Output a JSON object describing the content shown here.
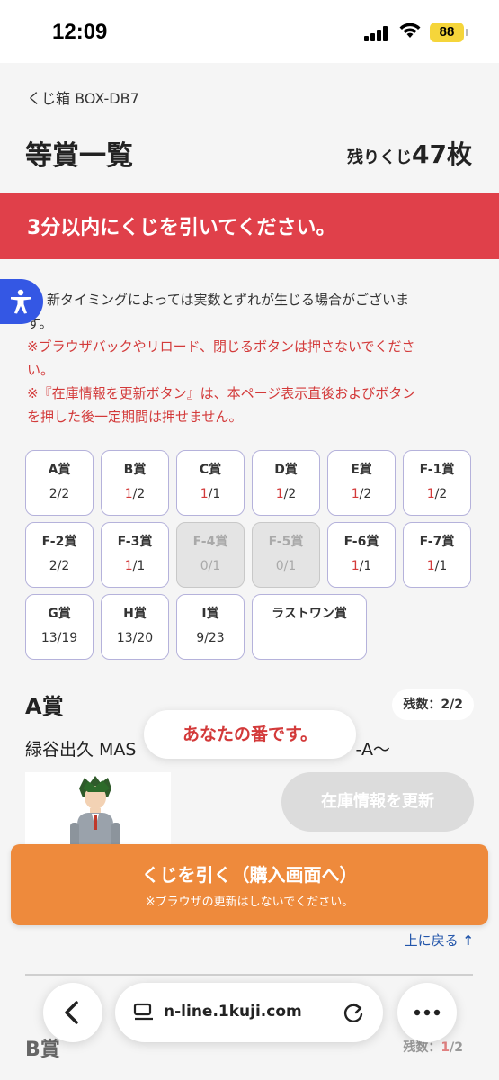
{
  "status": {
    "time": "12:09",
    "battery": "88"
  },
  "header": {
    "breadcrumb": "くじ箱 BOX-DB7",
    "title": "等賞一覧",
    "remaining_prefix": "残りくじ",
    "remaining_count": "47枚"
  },
  "alert": {
    "text": "3分以内にくじを引いてください。"
  },
  "notes": {
    "line1": "新タイミングによっては実数とずれが生じる場合がございま",
    "line2": "す。",
    "warn1": "※ブラウザバックやリロード、閉じるボタンは押さないでくださ",
    "warn2": "い。",
    "warn3": "※『在庫情報を更新ボタン』は、本ページ表示直後およびボタン",
    "warn4": "を押した後一定期間は押せません。"
  },
  "prizes": [
    {
      "name": "A賞",
      "left": "2",
      "total": "/2",
      "highlight": false,
      "disabled": false
    },
    {
      "name": "B賞",
      "left": "1",
      "total": "/2",
      "highlight": true,
      "disabled": false
    },
    {
      "name": "C賞",
      "left": "1",
      "total": "/1",
      "highlight": true,
      "disabled": false
    },
    {
      "name": "D賞",
      "left": "1",
      "total": "/2",
      "highlight": true,
      "disabled": false
    },
    {
      "name": "E賞",
      "left": "1",
      "total": "/2",
      "highlight": true,
      "disabled": false
    },
    {
      "name": "F-1賞",
      "left": "1",
      "total": "/2",
      "highlight": true,
      "disabled": false
    },
    {
      "name": "F-2賞",
      "left": "2",
      "total": "/2",
      "highlight": false,
      "disabled": false
    },
    {
      "name": "F-3賞",
      "left": "1",
      "total": "/1",
      "highlight": true,
      "disabled": false
    },
    {
      "name": "F-4賞",
      "left": "0",
      "total": "/1",
      "highlight": false,
      "disabled": true
    },
    {
      "name": "F-5賞",
      "left": "0",
      "total": "/1",
      "highlight": false,
      "disabled": true
    },
    {
      "name": "F-6賞",
      "left": "1",
      "total": "/1",
      "highlight": true,
      "disabled": false
    },
    {
      "name": "F-7賞",
      "left": "1",
      "total": "/1",
      "highlight": true,
      "disabled": false
    },
    {
      "name": "G賞",
      "left": "13",
      "total": "/19",
      "highlight": false,
      "disabled": false
    },
    {
      "name": "H賞",
      "left": "13",
      "total": "/20",
      "highlight": false,
      "disabled": false
    },
    {
      "name": "I賞",
      "left": "9",
      "total": "/23",
      "highlight": false,
      "disabled": false
    },
    {
      "name": "ラストワン賞",
      "left": "",
      "total": "",
      "highlight": false,
      "disabled": false
    }
  ],
  "section_a": {
    "title": "A賞",
    "remaining": "残数：2/2",
    "name": "緑谷出久 MAS",
    "name_tail": "-A〜"
  },
  "toast": "あなたの番です。",
  "refresh_button": "在庫情報を更新",
  "draw_button": {
    "main": "くじを引く（購入画面へ）",
    "sub": "※ブラウザの更新はしないでください。"
  },
  "back_to_top": "上に戻る",
  "section_b": {
    "title": "B賞",
    "remaining_prefix": "残数：",
    "remaining_left": "1",
    "remaining_total": "/2"
  },
  "browser": {
    "url": "n-line.1kuji.com"
  }
}
